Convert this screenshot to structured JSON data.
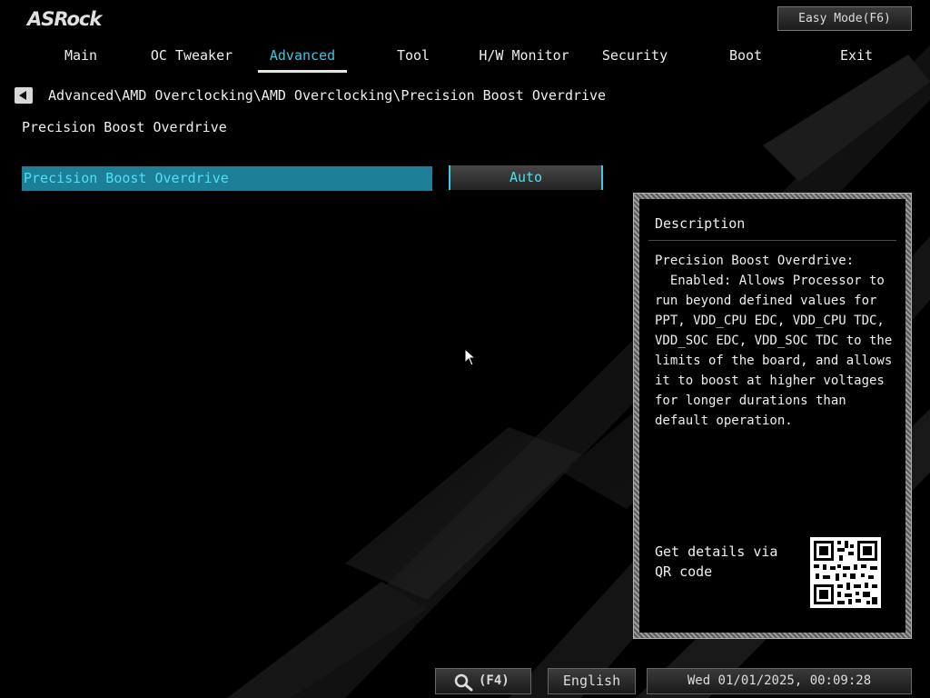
{
  "app": {
    "logo": "ASRock",
    "easy_mode_label": "Easy Mode(F6)"
  },
  "nav": {
    "tabs": [
      {
        "label": "Main",
        "active": false
      },
      {
        "label": "OC Tweaker",
        "active": false
      },
      {
        "label": "Advanced",
        "active": true
      },
      {
        "label": "Tool",
        "active": false
      },
      {
        "label": "H/W Monitor",
        "active": false
      },
      {
        "label": "Security",
        "active": false
      },
      {
        "label": "Boot",
        "active": false
      },
      {
        "label": "Exit",
        "active": false
      }
    ]
  },
  "breadcrumb": "Advanced\\AMD Overclocking\\AMD Overclocking\\Precision Boost Overdrive",
  "section_title": "Precision Boost Overdrive",
  "settings": [
    {
      "label": "Precision Boost Overdrive",
      "value": "Auto",
      "selected": true
    }
  ],
  "description": {
    "title": "Description",
    "text": "Precision Boost Overdrive:\n  Enabled: Allows Processor to\nrun beyond defined values for\nPPT, VDD_CPU EDC, VDD_CPU TDC,\nVDD_SOC EDC, VDD_SOC TDC to the\nlimits of the board, and allows\nit to boost at higher voltages\nfor longer durations than\ndefault operation.",
    "qr_label": "Get details via QR code"
  },
  "bottom": {
    "search_key": "(F4)",
    "language": "English",
    "datetime": "Wed 01/01/2025, 00:09:28"
  },
  "colors": {
    "accent": "#36c9e2",
    "selected_row_bg": "#1d7e98",
    "selected_text": "#4fe0f4"
  },
  "icons": [
    "back-arrow-icon",
    "search-icon",
    "qr-code-icon",
    "mouse-cursor-icon"
  ]
}
